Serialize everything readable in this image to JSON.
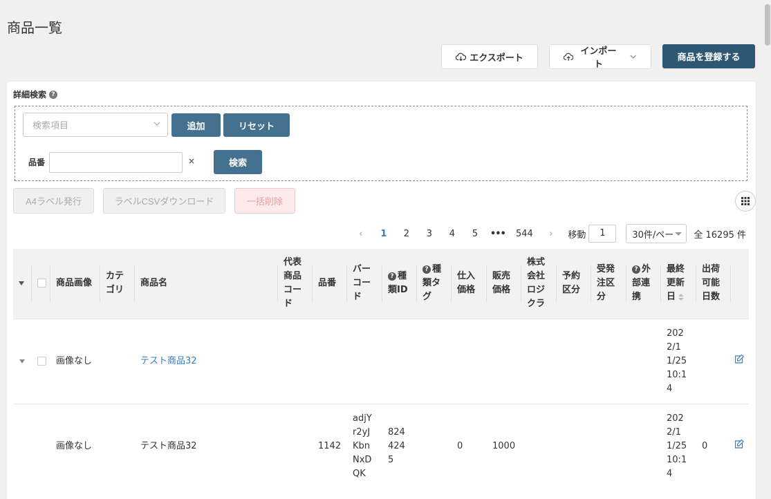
{
  "page": {
    "title": "商品一覧"
  },
  "top_actions": {
    "export_label": "エクスポート",
    "import_label": "インポート",
    "register_label": "商品を登録する"
  },
  "advanced_search": {
    "title": "詳細検索",
    "item_select_placeholder": "検索項目",
    "add_label": "追加",
    "reset_label": "リセット",
    "field_label": "品番",
    "field_value": "",
    "clear_label": "×",
    "search_label": "検索"
  },
  "actions": {
    "a4_label": "A4ラベル発行",
    "csv_label": "ラベルCSVダウンロード",
    "delete_label": "一括削除"
  },
  "pagination": {
    "prev": "‹",
    "pages": [
      "1",
      "2",
      "3",
      "4",
      "5"
    ],
    "active_page": "1",
    "ellipsis": "•••",
    "last_page": "544",
    "next": "›",
    "goto_label": "移動",
    "goto_value": "1",
    "per_page": "30件/ペー",
    "total": "全 16295 件"
  },
  "table": {
    "headers": {
      "image": "商品画像",
      "category": "カテゴリ",
      "name": "商品名",
      "code": "代表商品コード",
      "sku": "品番",
      "barcode": "バーコード",
      "type_id": "種類ID",
      "type_tag": "種類タグ",
      "cost": "仕入価格",
      "price": "販売価格",
      "logi": "株式会社ロジクラ",
      "reserve": "予約区分",
      "order": "受発注区分",
      "ext": "外部連携",
      "updated": "最終更新日",
      "ship_days": "出荷可能日数"
    },
    "rows": [
      {
        "image": "画像なし",
        "category": "",
        "name": "テスト商品32",
        "code": "",
        "sku": "",
        "barcode": "",
        "type_id": "",
        "type_tag": "",
        "cost": "",
        "price": "",
        "logi": "",
        "reserve": "",
        "order": "",
        "ext": "",
        "updated": "2022/11/25 10:14",
        "ship_days": ""
      },
      {
        "image": "画像なし",
        "category": "",
        "name": "テスト商品32",
        "code": "",
        "sku": "1142",
        "barcode": "adjYr2yJKbnNxDQK",
        "type_id": "8244245",
        "type_tag": "",
        "cost": "0",
        "price": "1000",
        "logi": "",
        "reserve": "",
        "order": "",
        "ext": "",
        "updated": "2022/11/25 10:14",
        "ship_days": "0"
      }
    ]
  }
}
